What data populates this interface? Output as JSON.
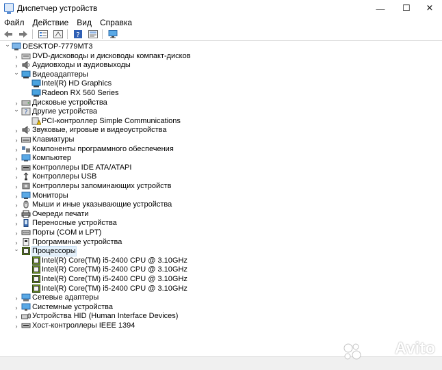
{
  "window": {
    "title": "Диспетчер устройств",
    "minimize": "—",
    "maximize": "☐",
    "close": "✕"
  },
  "menu": [
    "Файл",
    "Действие",
    "Вид",
    "Справка"
  ],
  "toolbar": {
    "icons": [
      "back-arrow-icon",
      "forward-arrow-icon",
      "properties-icon",
      "scan-hardware-icon",
      "help-icon",
      "show-hidden-icon",
      "monitor-icon"
    ]
  },
  "tree": [
    {
      "label": "DESKTOP-7779MT3",
      "level": 0,
      "expanded": true,
      "icon": "computer-icon"
    },
    {
      "label": "DVD-дисководы и дисководы компакт-дисков",
      "level": 1,
      "expanded": false,
      "icon": "dvd-icon"
    },
    {
      "label": "Аудиовходы и аудиовыходы",
      "level": 1,
      "expanded": false,
      "icon": "speaker-icon"
    },
    {
      "label": "Видеоадаптеры",
      "level": 1,
      "expanded": true,
      "icon": "display-adapter-icon"
    },
    {
      "label": "Intel(R) HD Graphics",
      "level": 2,
      "icon": "display-adapter-icon"
    },
    {
      "label": "Radeon RX 560 Series",
      "level": 2,
      "icon": "display-adapter-icon"
    },
    {
      "label": "Дисковые устройства",
      "level": 1,
      "expanded": false,
      "icon": "disk-icon"
    },
    {
      "label": "Другие устройства",
      "level": 1,
      "expanded": true,
      "icon": "unknown-device-icon"
    },
    {
      "label": "PCI-контроллер Simple Communications",
      "level": 2,
      "icon": "warning-device-icon"
    },
    {
      "label": "Звуковые, игровые и видеоустройства",
      "level": 1,
      "expanded": false,
      "icon": "speaker-icon"
    },
    {
      "label": "Клавиатуры",
      "level": 1,
      "expanded": false,
      "icon": "keyboard-icon"
    },
    {
      "label": "Компоненты программного обеспечения",
      "level": 1,
      "expanded": false,
      "icon": "component-icon"
    },
    {
      "label": "Компьютер",
      "level": 1,
      "expanded": false,
      "icon": "monitor-icon"
    },
    {
      "label": "Контроллеры IDE ATA/ATAPI",
      "level": 1,
      "expanded": false,
      "icon": "ide-icon"
    },
    {
      "label": "Контроллеры USB",
      "level": 1,
      "expanded": false,
      "icon": "usb-icon"
    },
    {
      "label": "Контроллеры запоминающих устройств",
      "level": 1,
      "expanded": false,
      "icon": "storage-icon"
    },
    {
      "label": "Мониторы",
      "level": 1,
      "expanded": false,
      "icon": "monitor-icon"
    },
    {
      "label": "Мыши и иные указывающие устройства",
      "level": 1,
      "expanded": false,
      "icon": "mouse-icon"
    },
    {
      "label": "Очереди печати",
      "level": 1,
      "expanded": false,
      "icon": "printer-icon"
    },
    {
      "label": "Переносные устройства",
      "level": 1,
      "expanded": false,
      "icon": "portable-device-icon"
    },
    {
      "label": "Порты (COM и LPT)",
      "level": 1,
      "expanded": false,
      "icon": "port-icon"
    },
    {
      "label": "Программные устройства",
      "level": 1,
      "expanded": false,
      "icon": "software-device-icon"
    },
    {
      "label": "Процессоры",
      "level": 1,
      "expanded": true,
      "selected": true,
      "icon": "processor-icon"
    },
    {
      "label": "Intel(R) Core(TM) i5-2400 CPU @ 3.10GHz",
      "level": 2,
      "icon": "processor-icon"
    },
    {
      "label": "Intel(R) Core(TM) i5-2400 CPU @ 3.10GHz",
      "level": 2,
      "icon": "processor-icon"
    },
    {
      "label": "Intel(R) Core(TM) i5-2400 CPU @ 3.10GHz",
      "level": 2,
      "icon": "processor-icon"
    },
    {
      "label": "Intel(R) Core(TM) i5-2400 CPU @ 3.10GHz",
      "level": 2,
      "icon": "processor-icon"
    },
    {
      "label": "Сетевые адаптеры",
      "level": 1,
      "expanded": false,
      "icon": "network-icon"
    },
    {
      "label": "Системные устройства",
      "level": 1,
      "expanded": false,
      "icon": "system-device-icon"
    },
    {
      "label": "Устройства HID (Human Interface Devices)",
      "level": 1,
      "expanded": false,
      "icon": "hid-icon"
    },
    {
      "label": "Хост-контроллеры IEEE 1394",
      "level": 1,
      "expanded": false,
      "icon": "ieee1394-icon"
    }
  ],
  "watermark": "Avito"
}
